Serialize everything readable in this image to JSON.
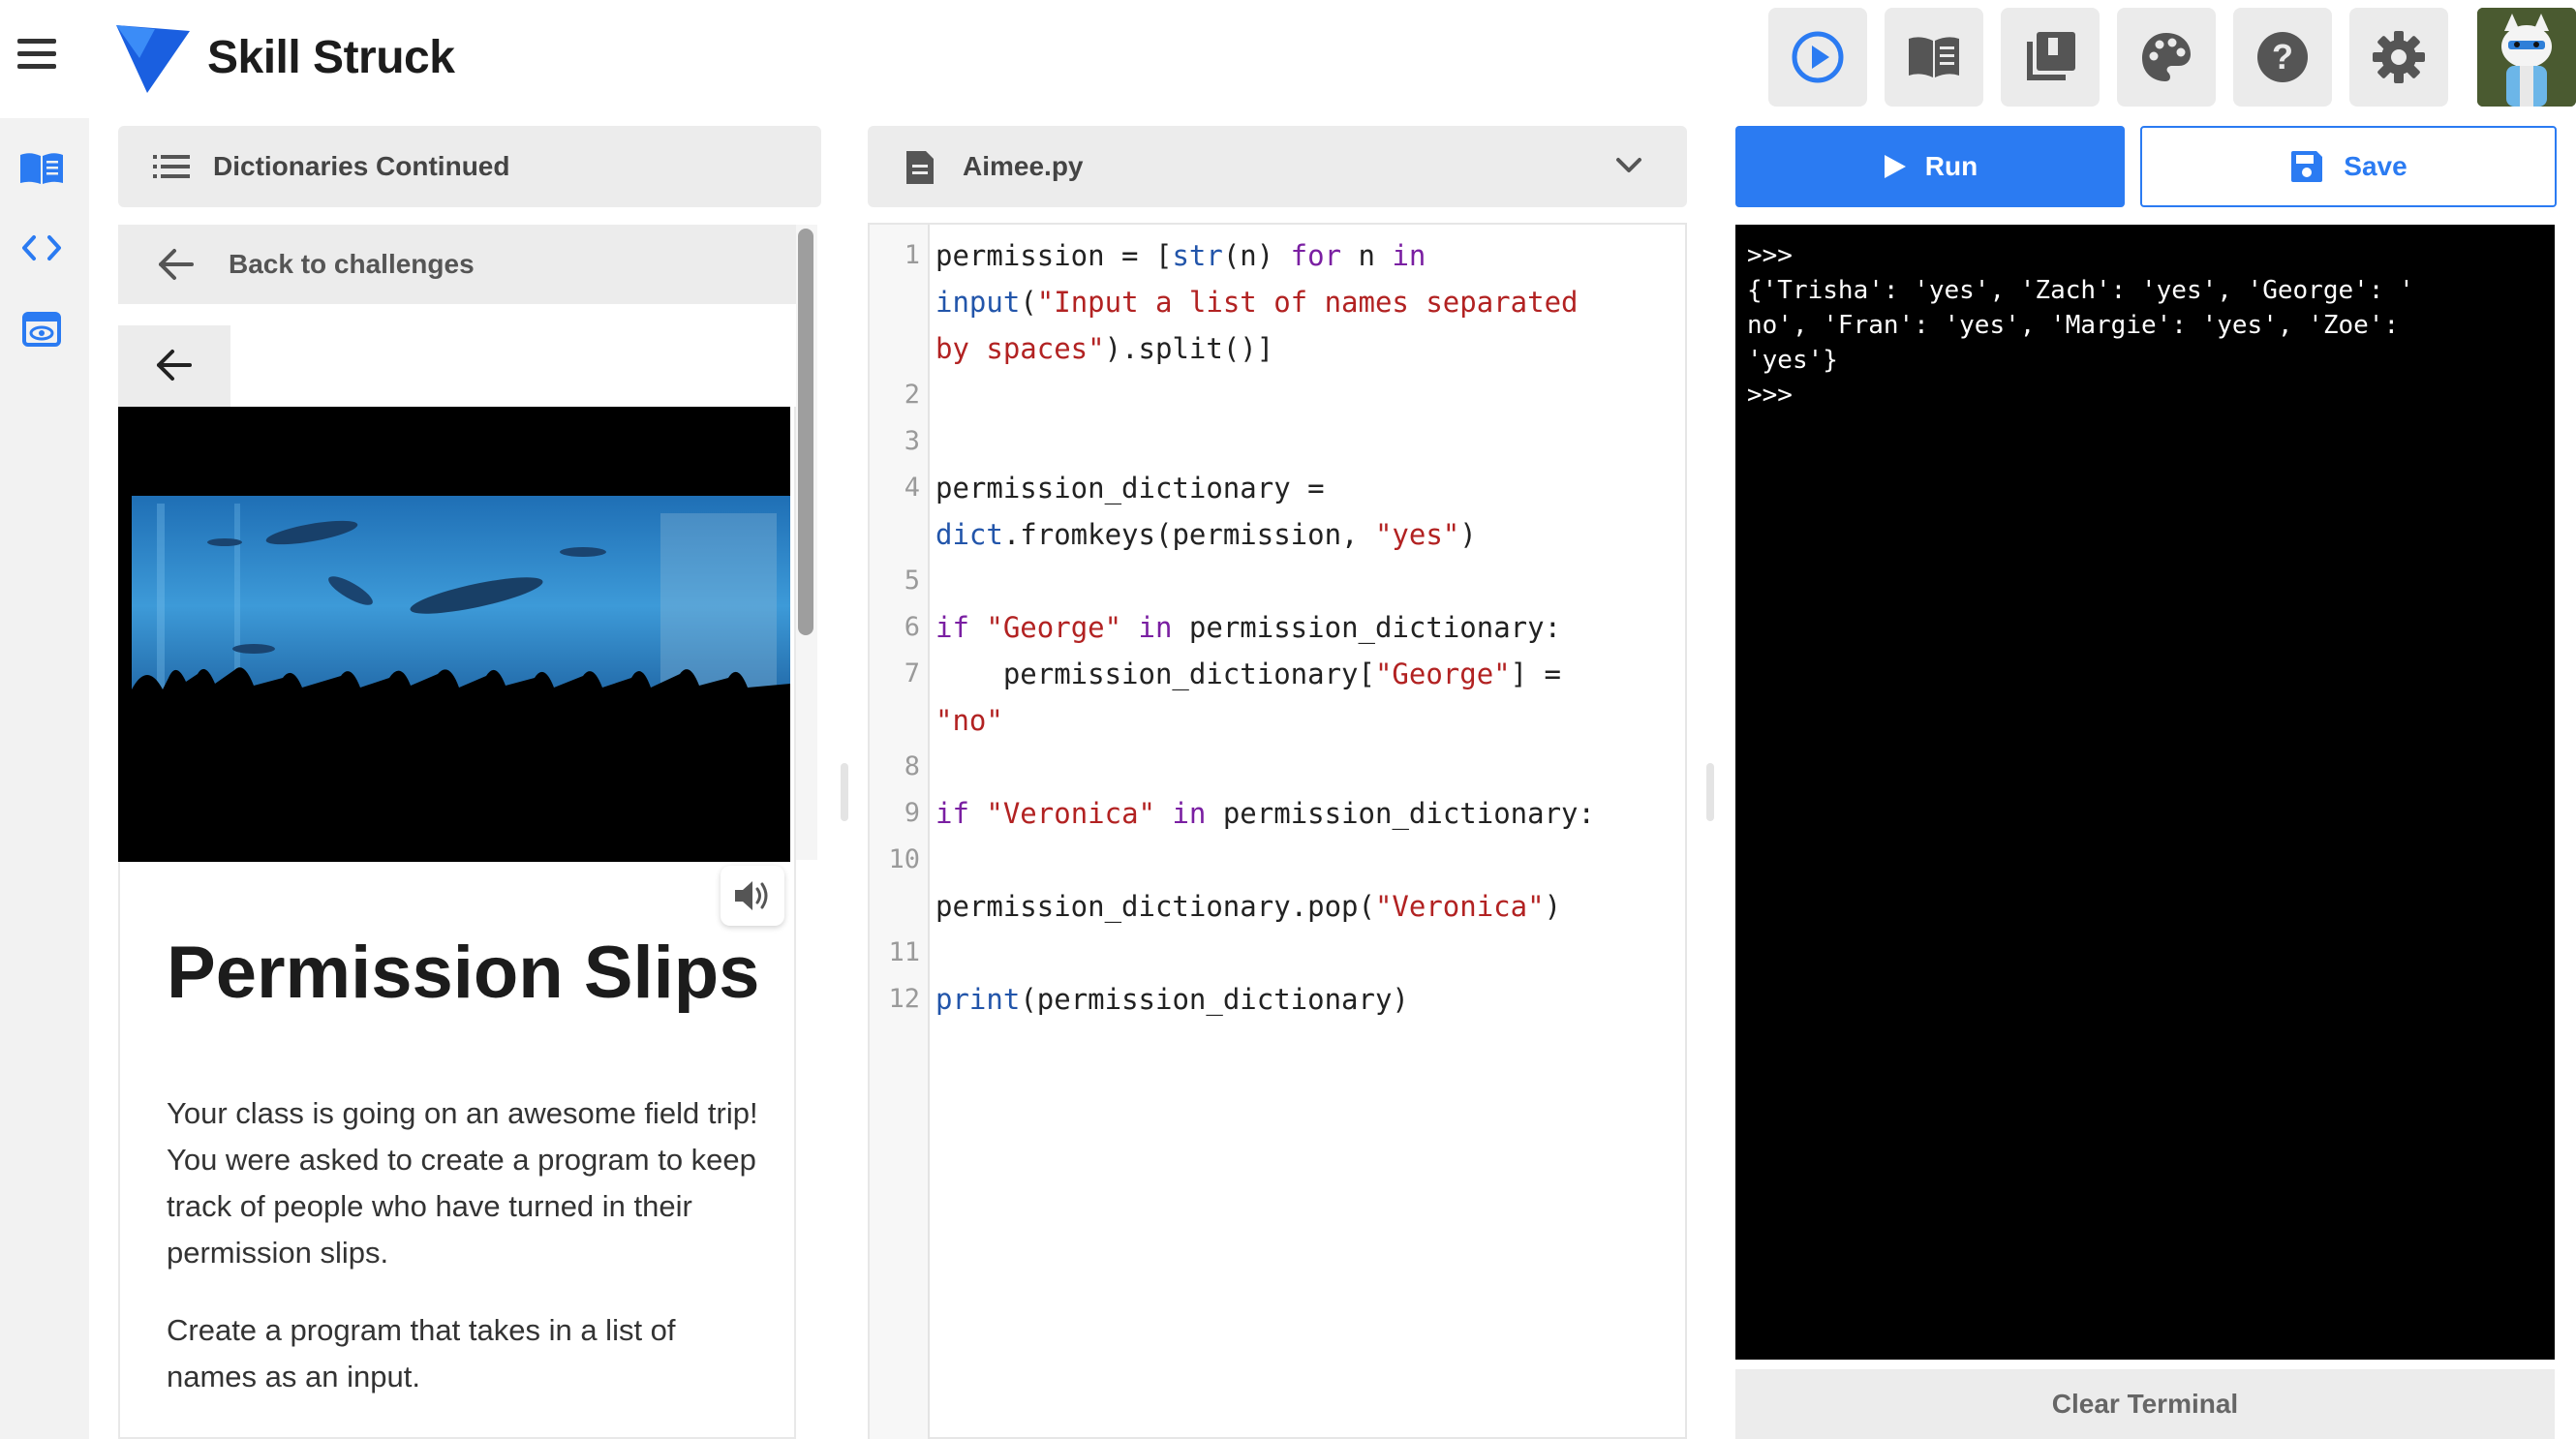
{
  "app": {
    "brand": "Skill Struck"
  },
  "lesson": {
    "section_title": "Dictionaries Continued",
    "back_label": "Back to challenges",
    "title": "Permission Slips",
    "paragraphs": [
      "Your class is going on an awesome field trip! You were asked to create a program to keep track of people who have turned in their permission slips.",
      "Create a program that takes in a list of names as an input."
    ]
  },
  "editor": {
    "filename": "Aimee.py",
    "line_numbers": [
      "1",
      "2",
      "3",
      "4",
      "5",
      "6",
      "7",
      "8",
      "9",
      "10",
      "11",
      "12"
    ]
  },
  "actions": {
    "run_label": "Run",
    "save_label": "Save",
    "clear_label": "Clear Terminal"
  },
  "terminal": {
    "lines": [
      ">>>",
      "{'Trisha': 'yes', 'Zach': 'yes', 'George': '",
      "no', 'Fran': 'yes', 'Margie': 'yes', 'Zoe':",
      "'yes'}",
      ">>>"
    ]
  },
  "colors": {
    "accent": "#2b7bf2",
    "terminal_bg": "#000000"
  }
}
